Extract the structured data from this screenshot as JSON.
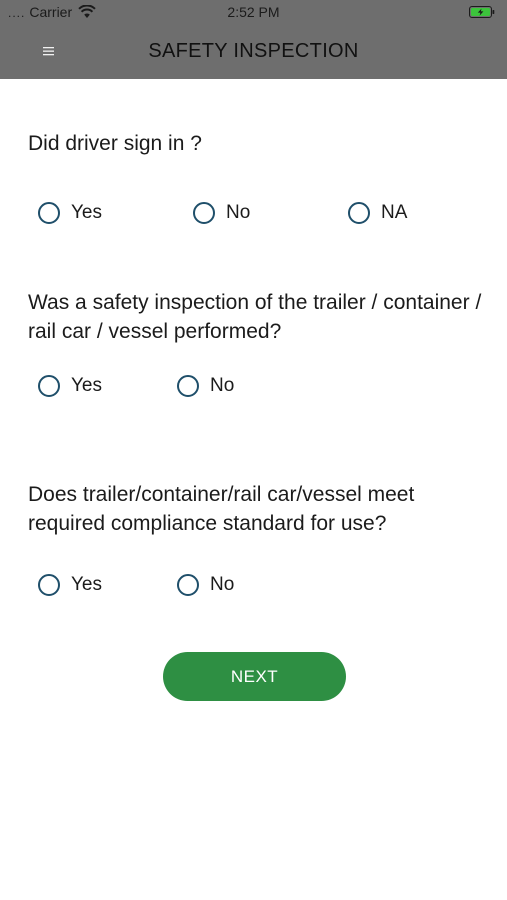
{
  "status_bar": {
    "signal": "....",
    "carrier": "Carrier",
    "time": "2:52 PM",
    "wifi_icon": "wifi-icon",
    "battery_icon": "battery-charging-icon",
    "battery_color": "#3cc43c"
  },
  "header": {
    "title": "SAFETY INSPECTION",
    "menu_icon": "menu-icon"
  },
  "questions": [
    {
      "text": "Did driver sign in ?",
      "options": [
        "Yes",
        "No",
        "NA"
      ],
      "selected": null
    },
    {
      "text": "Was a safety inspection of the trailer / container / rail car / vessel performed?",
      "options": [
        "Yes",
        "No"
      ],
      "selected": null
    },
    {
      "text": "Does trailer/container/rail car/vessel meet required compliance standard for use?",
      "options": [
        "Yes",
        "No"
      ],
      "selected": null
    }
  ],
  "next_button": {
    "label": "NEXT",
    "color": "#2e8f43"
  },
  "colors": {
    "header_bg": "#6e6e6e",
    "radio_border": "#1f4f6a"
  }
}
